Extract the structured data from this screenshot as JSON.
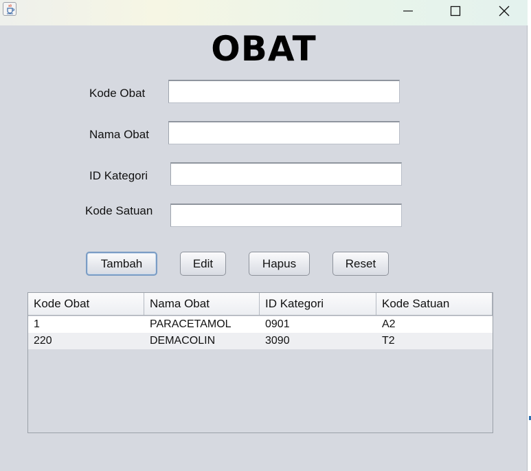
{
  "window": {
    "icon": "java-cup-icon",
    "controls": [
      "minimize-icon",
      "maximize-icon",
      "close-icon"
    ]
  },
  "form": {
    "title": "OBAT",
    "fields": [
      {
        "label": "Kode Obat",
        "value": ""
      },
      {
        "label": "Nama Obat",
        "value": ""
      },
      {
        "label": "ID Kategori",
        "value": ""
      },
      {
        "label": "Kode Satuan",
        "value": ""
      }
    ]
  },
  "buttons": {
    "tambah": "Tambah",
    "edit": "Edit",
    "hapus": "Hapus",
    "reset": "Reset"
  },
  "table": {
    "columns": [
      "Kode Obat",
      "Nama Obat",
      "ID Kategori",
      "Kode Satuan"
    ],
    "rows": [
      [
        "1",
        "PARACETAMOL",
        "0901",
        "A2"
      ],
      [
        "220",
        "DEMACOLIN",
        "3090",
        "T2"
      ]
    ]
  },
  "colors": {
    "window_bg": "#d6d9e0",
    "row_alt": "#eeeff2",
    "focus_border": "#7a9cc4"
  }
}
